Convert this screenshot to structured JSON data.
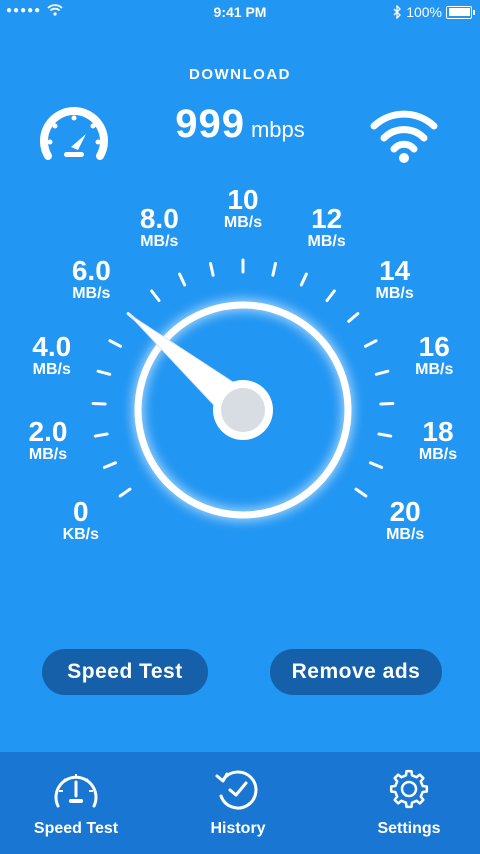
{
  "colors": {
    "background": "#2196f3",
    "button": "#1560a8",
    "tab_bar": "#1976d2",
    "needle": "#ffffff"
  },
  "status_bar": {
    "signal": "●●●●●",
    "time": "9:41 PM",
    "battery": "100%"
  },
  "header": {
    "label": "DOWNLOAD",
    "speed_value": "999",
    "speed_unit": "mbps"
  },
  "gauge": {
    "needle_value": 6.0,
    "labels": [
      {
        "value": "0",
        "unit": "KB/s"
      },
      {
        "value": "2.0",
        "unit": "MB/s"
      },
      {
        "value": "4.0",
        "unit": "MB/s"
      },
      {
        "value": "6.0",
        "unit": "MB/s"
      },
      {
        "value": "8.0",
        "unit": "MB/s"
      },
      {
        "value": "10",
        "unit": "MB/s"
      },
      {
        "value": "12",
        "unit": "MB/s"
      },
      {
        "value": "14",
        "unit": "MB/s"
      },
      {
        "value": "16",
        "unit": "MB/s"
      },
      {
        "value": "18",
        "unit": "MB/s"
      },
      {
        "value": "20",
        "unit": "MB/s"
      }
    ]
  },
  "actions": {
    "speed_test": "Speed Test",
    "remove_ads": "Remove ads"
  },
  "tabs": [
    {
      "label": "Speed Test",
      "icon": "speedometer-icon"
    },
    {
      "label": "History",
      "icon": "history-clock-icon"
    },
    {
      "label": "Settings",
      "icon": "gear-icon"
    }
  ]
}
